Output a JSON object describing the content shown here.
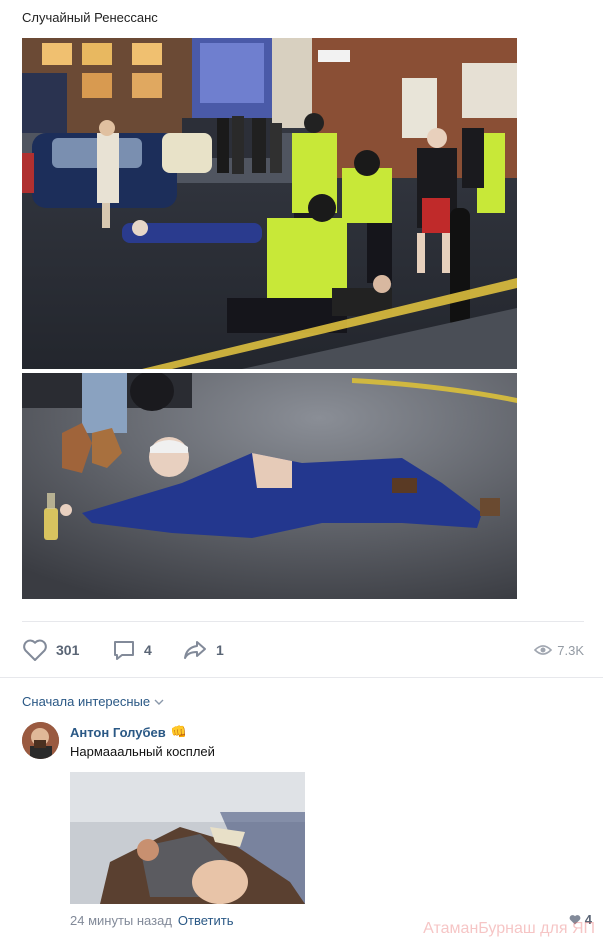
{
  "post": {
    "title": "Случайный Ренессанс",
    "images": [
      {
        "name": "police-arrest-night-street-photo"
      },
      {
        "name": "man-lying-on-road-with-beer-photo"
      }
    ]
  },
  "actions": {
    "likes": "301",
    "comments": "4",
    "shares": "1",
    "views": "7.3K"
  },
  "comments_section": {
    "sort_label": "Сначала интересные"
  },
  "comment": {
    "author": "Антон Голубев",
    "author_emoji": "👊",
    "text": "Нармааальный косплей",
    "time": "24 минуты назад",
    "reply_label": "Ответить",
    "likes": "4"
  },
  "watermark": "АтаманБурнаш для ЯП",
  "colors": {
    "link": "#2a5885",
    "icon": "#828a99",
    "divider": "#e7e8ec"
  },
  "icons": [
    "heart-icon",
    "comment-icon",
    "share-icon",
    "eye-icon",
    "chevron-down-icon",
    "fist-emoji-icon"
  ]
}
